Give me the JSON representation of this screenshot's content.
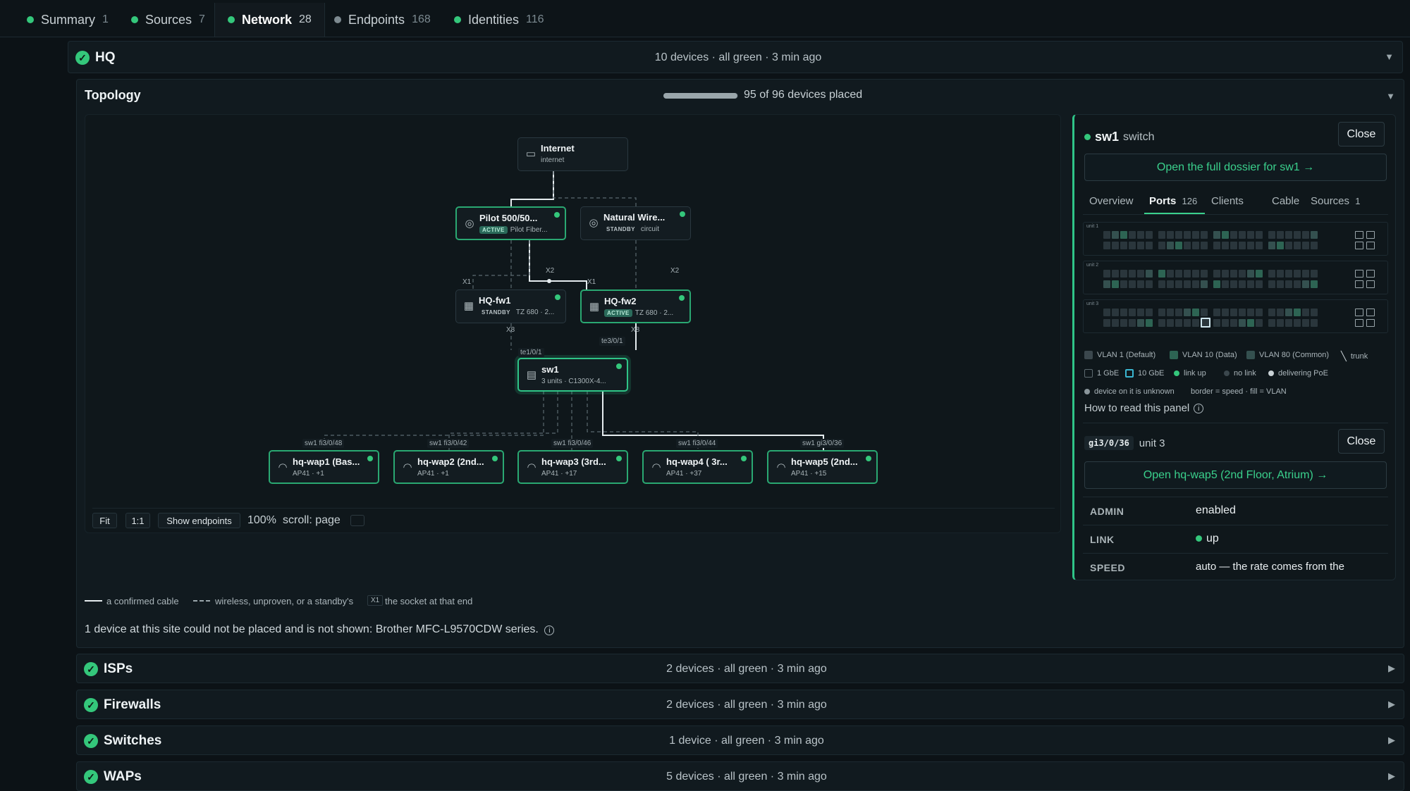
{
  "tabs": [
    {
      "label": "Summary",
      "count": "1",
      "status": "green"
    },
    {
      "label": "Sources",
      "count": "7",
      "status": "green"
    },
    {
      "label": "Network",
      "count": "28",
      "status": "green"
    },
    {
      "label": "Endpoints",
      "count": "168",
      "status": "gray"
    },
    {
      "label": "Identities",
      "count": "116",
      "status": "green"
    }
  ],
  "hq": {
    "title": "HQ",
    "summary": "10 devices · all green · 3 min ago"
  },
  "topology": {
    "title": "Topology",
    "progress_text": "95 of 96 devices placed",
    "progress_fraction": 0.99,
    "nodes": {
      "internet": {
        "title": "Internet",
        "sub": "internet"
      },
      "pilot": {
        "title": "Pilot 500/50...",
        "badge": "ACTIVE",
        "sub": "Pilot Fiber..."
      },
      "natural": {
        "title": "Natural Wire...",
        "badge": "STANDBY",
        "sub": "circuit"
      },
      "fw1": {
        "title": "HQ-fw1",
        "badge": "STANDBY",
        "sub": "TZ 680 · 2..."
      },
      "fw2": {
        "title": "HQ-fw2",
        "badge": "ACTIVE",
        "sub": "TZ 680 · 2..."
      },
      "sw1": {
        "title": "sw1",
        "sub": "3 units · C1300X-4..."
      },
      "wap1": {
        "title": "hq-wap1 (Bas...",
        "sub": "AP41 · +1"
      },
      "wap2": {
        "title": "hq-wap2 (2nd...",
        "sub": "AP41 · +1"
      },
      "wap3": {
        "title": "hq-wap3 (3rd...",
        "sub": "AP41 · +17"
      },
      "wap4": {
        "title": "hq-wap4 ( 3r...",
        "sub": "AP41 · +37"
      },
      "wap5": {
        "title": "hq-wap5 (2nd...",
        "sub": "AP41 · +15"
      }
    },
    "ports": {
      "x2a": "X2",
      "x1a": "X1",
      "x2b": "X2",
      "x1b": "X1",
      "x8a": "X8",
      "x8b": "X8",
      "te10": "te1/0/1",
      "te30": "te3/0/1",
      "p48": "sw1 fi3/0/48",
      "p42": "sw1 fi3/0/42",
      "p46": "sw1 fi3/0/46",
      "p44": "sw1 fi3/0/44",
      "p36": "sw1 gi3/0/36"
    },
    "controls": {
      "fit": "Fit",
      "one": "1:1",
      "show": "Show endpoints",
      "zoom": "100%",
      "scroll": "scroll: page"
    },
    "legend": {
      "confirmed": "a confirmed cable",
      "wireless": "wireless, unproven, or a standby's",
      "socket_box": "X1",
      "socket": "the socket at that end"
    },
    "unplaced": "1 device at this site could not be placed and is not shown: Brother MFC-L9570CDW series."
  },
  "panel": {
    "name": "sw1",
    "kind": "switch",
    "close": "Close",
    "dossier": "Open the full dossier for sw1 →",
    "tabs": [
      {
        "label": "Overview"
      },
      {
        "label": "Ports",
        "count": "126"
      },
      {
        "label": "Clients"
      },
      {
        "label": "Cable"
      },
      {
        "label": "Sources",
        "count": "1"
      }
    ],
    "units": [
      "unit 1",
      "unit 2",
      "unit 3"
    ],
    "legend": {
      "vlan1": "VLAN 1 (Default)",
      "vlan10": "VLAN 10 (Data)",
      "vlan80": "VLAN 80 (Common)",
      "trunk": "trunk",
      "g1": "1 GbE",
      "g10": "10 GbE",
      "up": "link up",
      "nolink": "no link",
      "poe": "delivering PoE",
      "unknown": "device on it is unknown",
      "hint": "border = speed · fill = VLAN"
    },
    "howto": "How to read this panel",
    "port": {
      "id": "gi3/0/36",
      "unit": "unit 3",
      "close": "Close",
      "open": "Open hq-wap5 (2nd Floor, Atrium) →"
    },
    "kv": [
      {
        "k": "ADMIN",
        "v": "enabled"
      },
      {
        "k": "LINK",
        "v": "up"
      },
      {
        "k": "SPEED",
        "v": "auto — the rate comes from the"
      }
    ]
  },
  "sections": [
    {
      "title": "ISPs",
      "summary": "2 devices · all green · 3 min ago"
    },
    {
      "title": "Firewalls",
      "summary": "2 devices · all green · 3 min ago"
    },
    {
      "title": "Switches",
      "summary": "1 device · all green · 3 min ago"
    },
    {
      "title": "WAPs",
      "summary": "5 devices · all green · 3 min ago"
    }
  ]
}
